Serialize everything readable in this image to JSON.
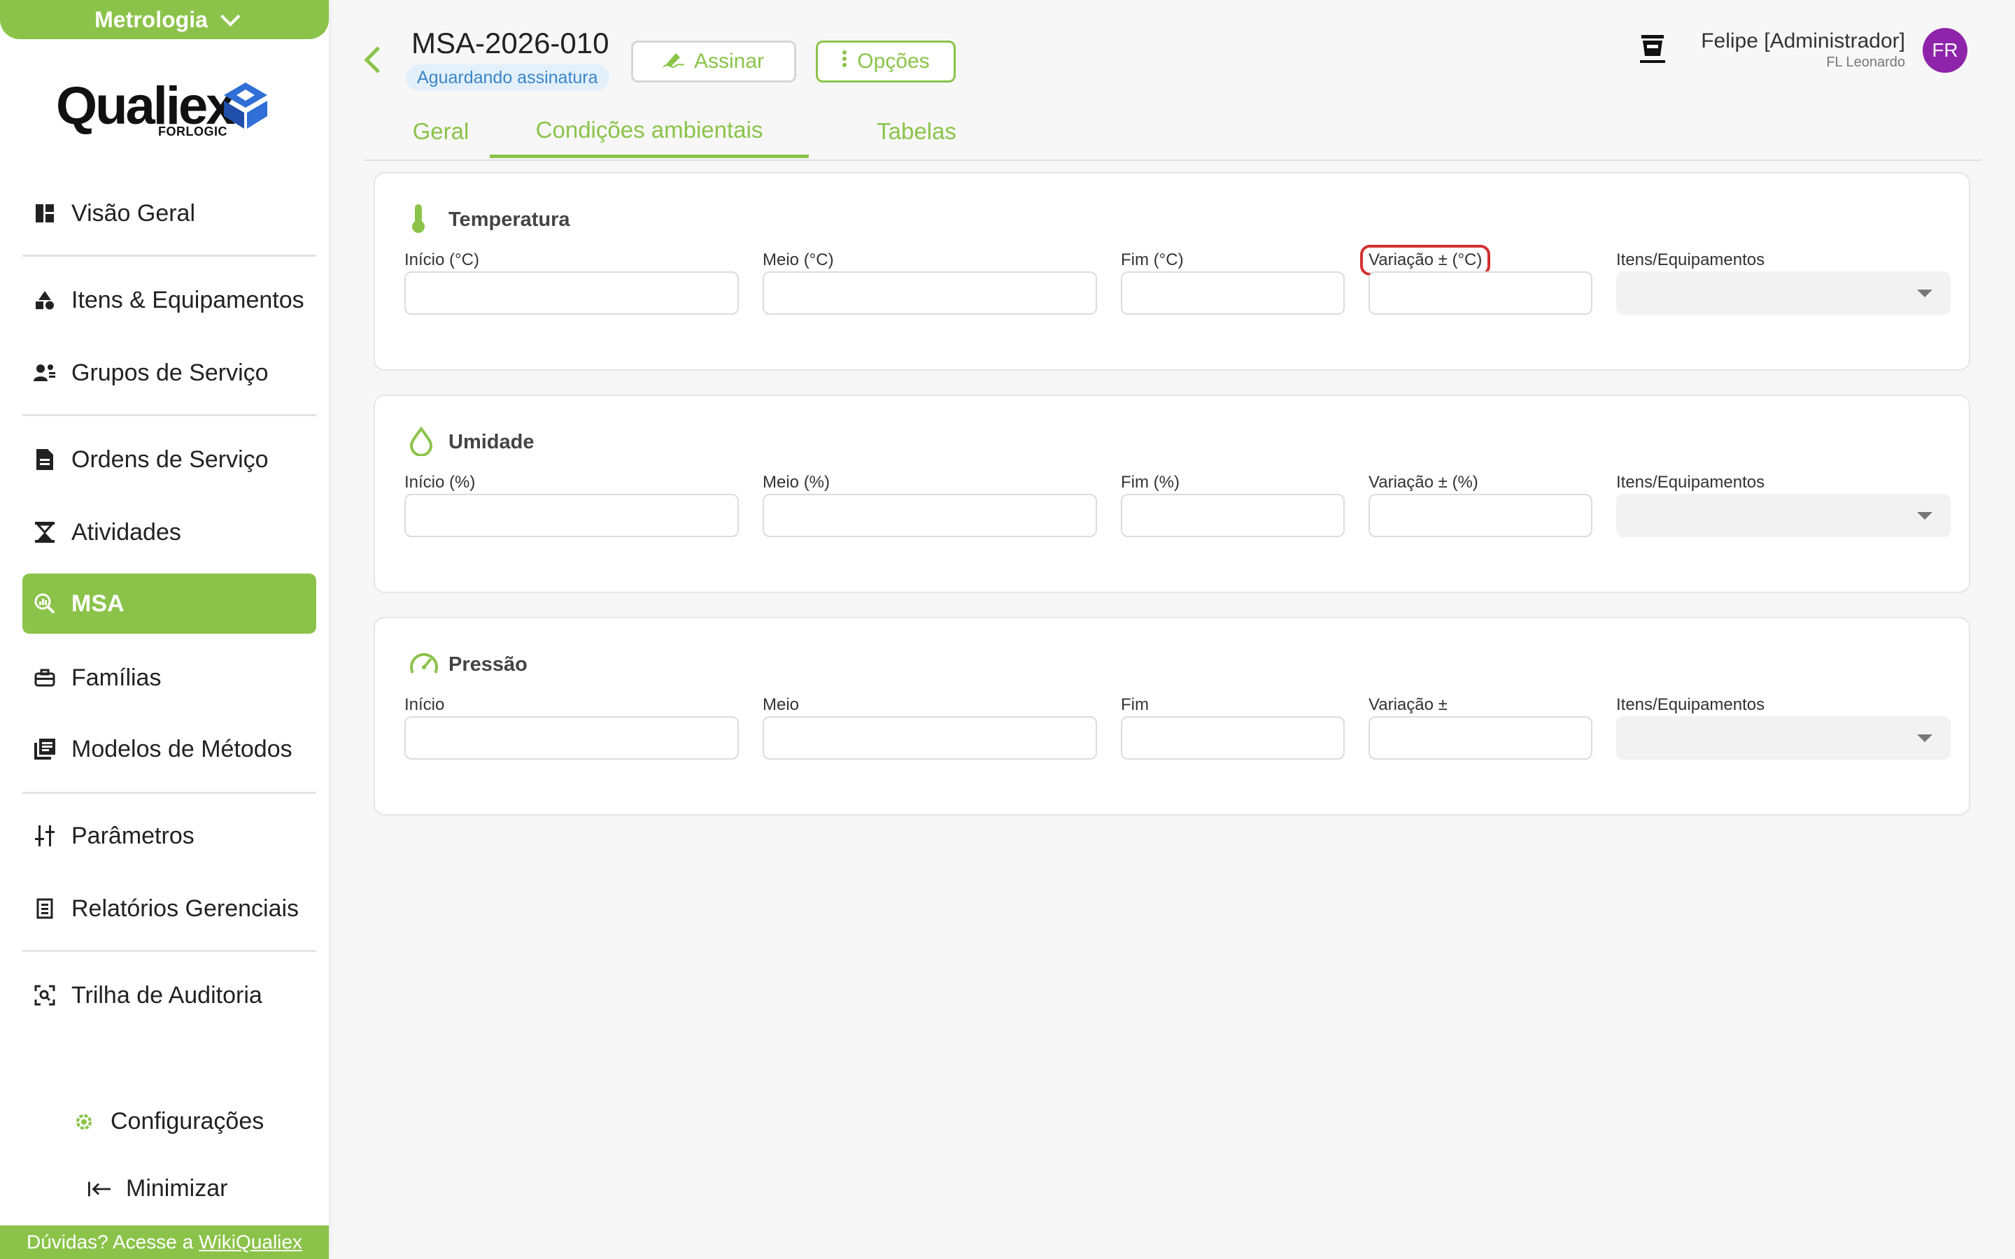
{
  "module": {
    "label": "Metrologia"
  },
  "logo": {
    "brand": "Qualiex",
    "sub": "FORLOGIC"
  },
  "sidebar": {
    "items": [
      {
        "label": "Visão Geral",
        "icon": "dashboard-icon"
      },
      {
        "label": "Itens & Equipamentos",
        "icon": "shapes-icon"
      },
      {
        "label": "Grupos de Serviço",
        "icon": "group-icon"
      },
      {
        "label": "Ordens de Serviço",
        "icon": "document-icon"
      },
      {
        "label": "Atividades",
        "icon": "hourglass-icon"
      },
      {
        "label": "MSA",
        "icon": "magnify-chart-icon"
      },
      {
        "label": "Famílias",
        "icon": "toolbox-icon"
      },
      {
        "label": "Modelos de Métodos",
        "icon": "library-icon"
      },
      {
        "label": "Parâmetros",
        "icon": "sliders-icon"
      },
      {
        "label": "Relatórios Gerenciais",
        "icon": "report-icon"
      },
      {
        "label": "Trilha de Auditoria",
        "icon": "audit-icon"
      }
    ],
    "settings_label": "Configurações",
    "minimize_label": "Minimizar",
    "help_text": "Dúvidas? Acesse a",
    "help_link": "WikiQualiex"
  },
  "header": {
    "title": "MSA-2026-010",
    "status": "Aguardando assinatura",
    "sign_label": "Assinar",
    "options_label": "Opções",
    "user_name": "Felipe [Administrador]",
    "user_company": "FL Leonardo",
    "avatar_initials": "FR"
  },
  "tabs": [
    {
      "label": "Geral"
    },
    {
      "label": "Condições ambientais"
    },
    {
      "label": "Tabelas"
    }
  ],
  "sections": [
    {
      "title": "Temperatura",
      "icon": "thermometer-icon",
      "fields": {
        "start": {
          "label": "Início (°C)",
          "value": ""
        },
        "middle": {
          "label": "Meio (°C)",
          "value": ""
        },
        "end": {
          "label": "Fim (°C)",
          "value": ""
        },
        "variation": {
          "label": "Variação ± (°C)",
          "value": ""
        },
        "items": {
          "label": "Itens/Equipamentos",
          "value": ""
        }
      }
    },
    {
      "title": "Umidade",
      "icon": "drop-icon",
      "fields": {
        "start": {
          "label": "Início (%)",
          "value": ""
        },
        "middle": {
          "label": "Meio (%)",
          "value": ""
        },
        "end": {
          "label": "Fim (%)",
          "value": ""
        },
        "variation": {
          "label": "Variação ± (%)",
          "value": ""
        },
        "items": {
          "label": "Itens/Equipamentos",
          "value": ""
        }
      }
    },
    {
      "title": "Pressão",
      "icon": "gauge-icon",
      "fields": {
        "start": {
          "label": "Início",
          "value": ""
        },
        "middle": {
          "label": "Meio",
          "value": ""
        },
        "end": {
          "label": "Fim",
          "value": ""
        },
        "variation": {
          "label": "Variação ±",
          "value": ""
        },
        "items": {
          "label": "Itens/Equipamentos",
          "value": ""
        }
      }
    }
  ],
  "colors": {
    "accent": "#8bc34a",
    "badge_bg": "#e3f0fb",
    "badge_text": "#3a86c8",
    "avatar": "#8e24aa",
    "highlight": "#d32f2f"
  }
}
